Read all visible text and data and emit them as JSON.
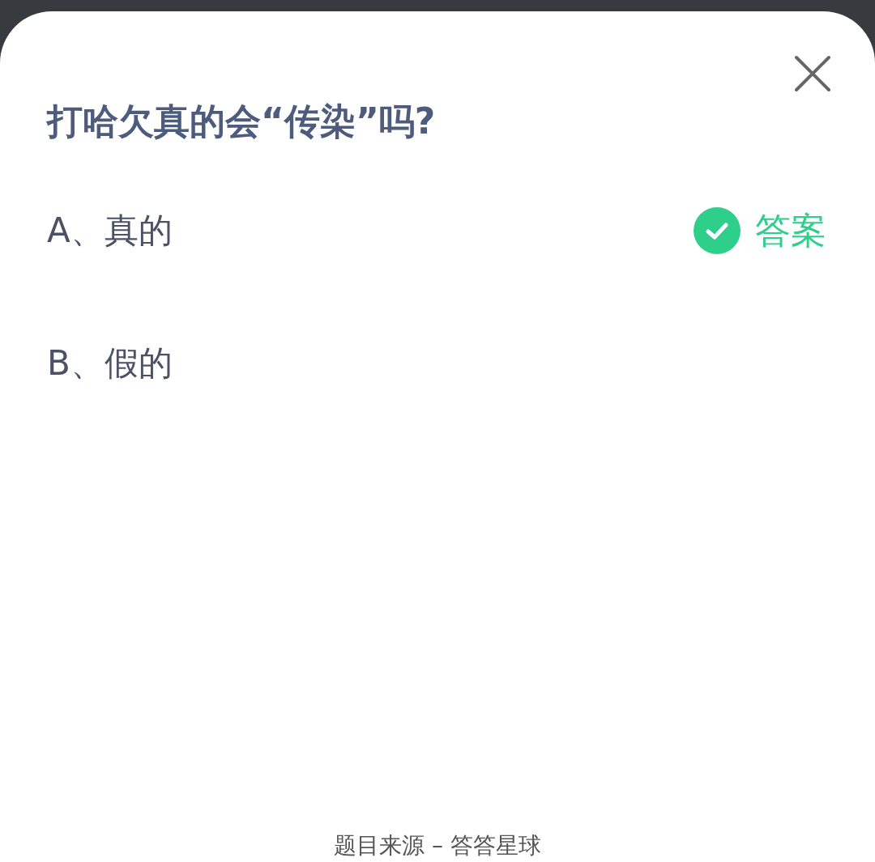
{
  "question": "打哈欠真的会“传染”吗?",
  "answer_label": "答案",
  "options": [
    {
      "label": "A、真的",
      "correct": true
    },
    {
      "label": "B、假的",
      "correct": false
    }
  ],
  "footer": "题目来源 – 答答星球"
}
